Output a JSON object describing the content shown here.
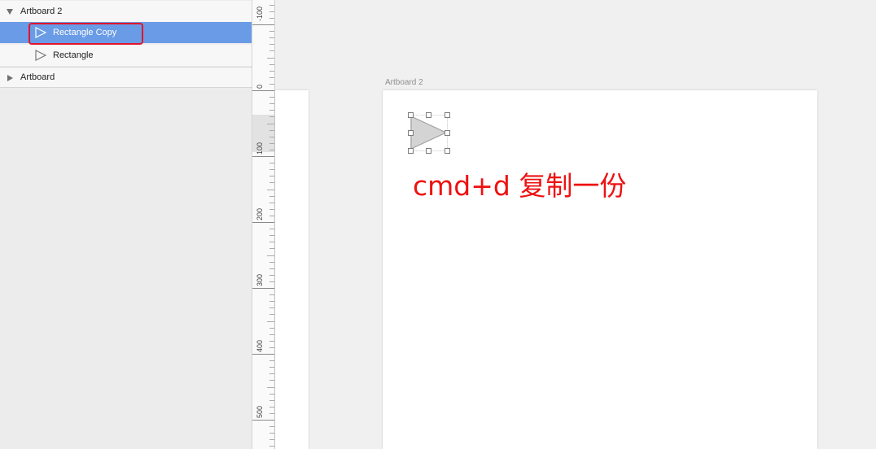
{
  "layers": {
    "artboard_2": {
      "label": "Artboard 2",
      "expanded": true
    },
    "rectangle_copy": {
      "label": "Rectangle Copy",
      "selected": true
    },
    "rectangle": {
      "label": "Rectangle"
    },
    "artboard": {
      "label": "Artboard",
      "expanded": false
    }
  },
  "ruler": {
    "labels": [
      "-100",
      "0",
      "100",
      "200",
      "300",
      "400",
      "500"
    ]
  },
  "canvas": {
    "artboard_title": "Artboard 2",
    "annotation": "cmd+d 复制一份",
    "annotation_color": "#ee1111"
  },
  "colors": {
    "selection": "#6a9be6",
    "highlight_border": "#e0162b"
  }
}
